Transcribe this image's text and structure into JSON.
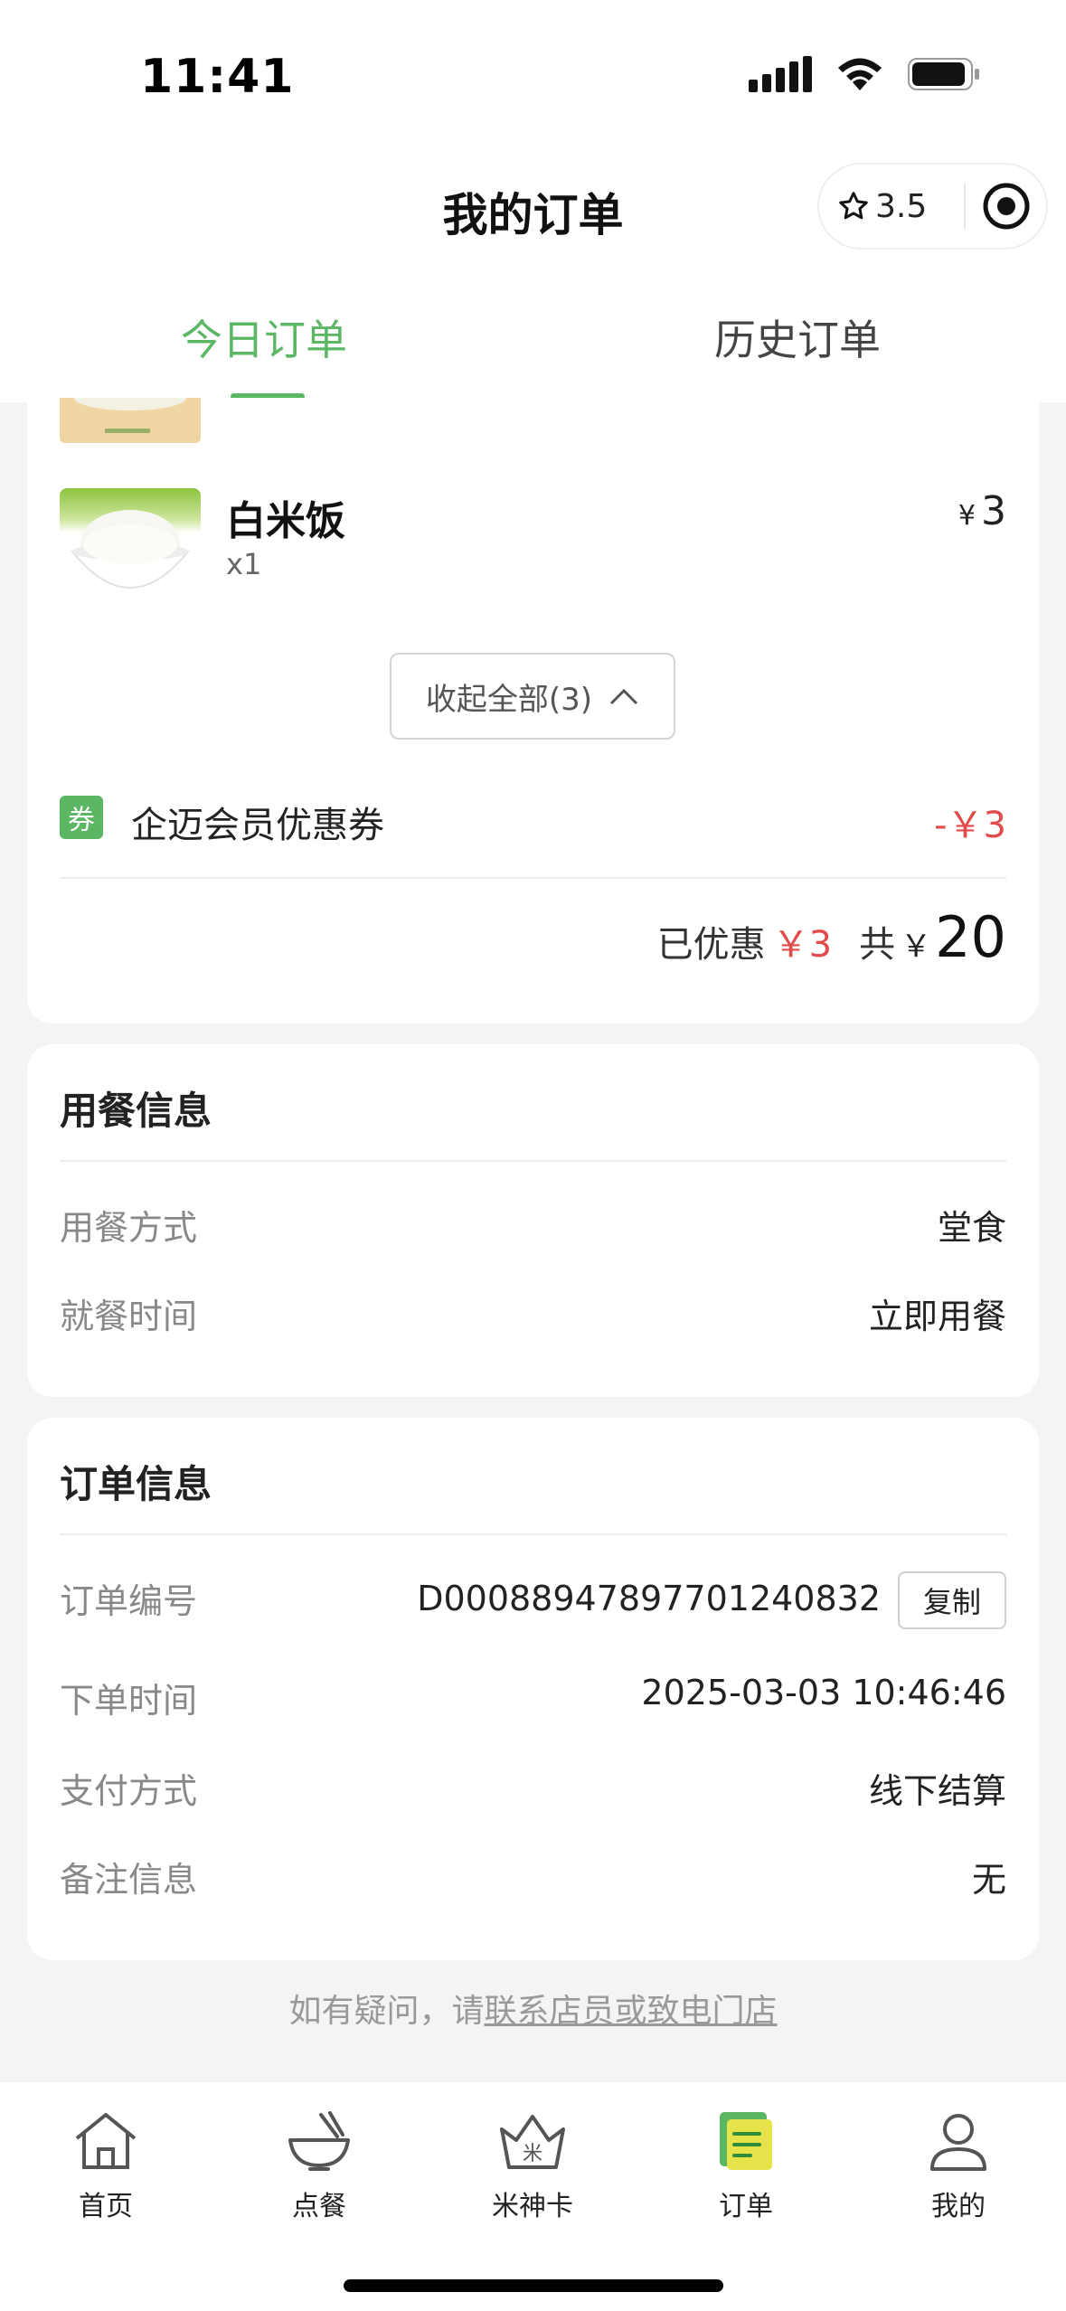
{
  "status_bar": {
    "time": "11:41"
  },
  "nav": {
    "title": "我的订单",
    "rating": "3.5"
  },
  "tabs": [
    {
      "label": "今日订单",
      "active": true
    },
    {
      "label": "历史订单",
      "active": false
    }
  ],
  "order": {
    "items": [
      {
        "name": "白米饭",
        "qty": "x1",
        "currency": "¥",
        "price": "3"
      }
    ],
    "collapse_label": "收起全部(3)",
    "coupon": {
      "icon_text": "券",
      "label": "企迈会员优惠券",
      "amount": "-￥3"
    },
    "discount_label": "已优惠",
    "discount_amount": "￥3",
    "total_label": "共",
    "total_currency": "￥",
    "total_amount": "20"
  },
  "dining_info": {
    "title": "用餐信息",
    "rows": [
      {
        "label": "用餐方式",
        "value": "堂食"
      },
      {
        "label": "就餐时间",
        "value": "立即用餐"
      }
    ]
  },
  "order_info": {
    "title": "订单信息",
    "rows": [
      {
        "label": "订单编号",
        "value": "D0008894789770124083 2"
      },
      {
        "label": "下单时间",
        "value": "2025-03-03 10:46:46"
      },
      {
        "label": "支付方式",
        "value": "线下结算"
      },
      {
        "label": "备注信息",
        "value": "无"
      }
    ],
    "order_no": "D000889478977012408 32",
    "copy_label": "复制"
  },
  "help": {
    "prefix": "如有疑问，请",
    "link": "联系店员或致电门店"
  },
  "tabbar": [
    {
      "label": "首页",
      "icon": "home-icon"
    },
    {
      "label": "点餐",
      "icon": "bowl-icon"
    },
    {
      "label": "米神卡",
      "icon": "crown-card-icon"
    },
    {
      "label": "订单",
      "icon": "order-icon",
      "active": true
    },
    {
      "label": "我的",
      "icon": "person-icon"
    }
  ],
  "colors": {
    "accent": "#5cb765",
    "discount": "#e14b4b"
  }
}
